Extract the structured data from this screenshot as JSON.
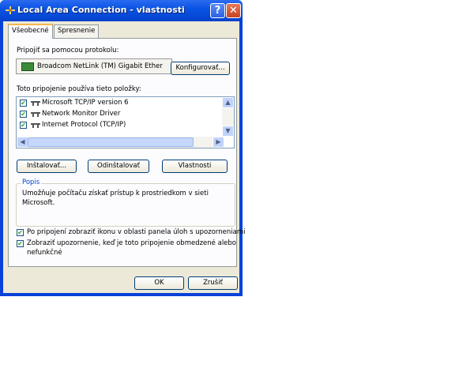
{
  "window": {
    "title": "Local Area Connection - vlastnosti",
    "help_label": "?",
    "close_label": "✕"
  },
  "tabs": [
    {
      "label": "Všeobecné",
      "active": true
    },
    {
      "label": "Spresnenie",
      "active": false
    }
  ],
  "general": {
    "connect_using_label": "Pripojiť sa pomocou protokolu:",
    "adapter_name": "Broadcom NetLink (TM) Gigabit Ether",
    "configure_label": "Konfigurovať...",
    "items_label": "Toto pripojenie používa tieto položky:",
    "items": [
      {
        "label": "Microsoft TCP/IP version 6",
        "checked": true
      },
      {
        "label": "Network Monitor Driver",
        "checked": true
      },
      {
        "label": "Internet Protocol (TCP/IP)",
        "checked": true
      }
    ],
    "install_label": "Inštalovať...",
    "uninstall_label": "Odinštalovať",
    "properties_label": "Vlastnosti",
    "description_title": "Popis",
    "description_text_1": "Umožňuje počítaču získať prístup k prostriedkom v sieti",
    "description_text_2": "Microsoft.",
    "show_icon_label": "Po pripojení zobraziť ikonu v oblasti panela úloh s upozorneniami",
    "show_icon_checked": true,
    "notify_label_1": "Zobraziť upozornenie, keď je toto pripojenie obmedzené alebo",
    "notify_label_2": "nefunkčné",
    "notify_checked": true
  },
  "footer": {
    "ok_label": "OK",
    "cancel_label": "Zrušiť"
  },
  "colors": {
    "titlebar": "#0a54e3",
    "dialog_face": "#ece9d8",
    "group_title": "#0046d5",
    "check_mark": "#21a121"
  }
}
